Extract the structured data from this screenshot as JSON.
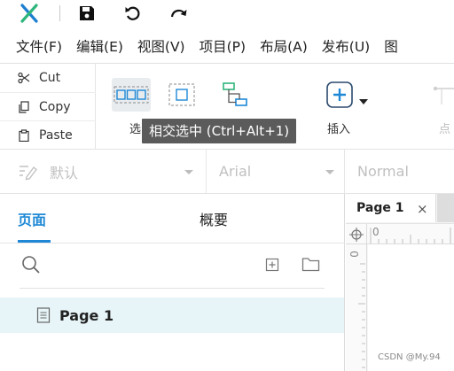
{
  "menu": [
    "文件(F)",
    "编辑(E)",
    "视图(V)",
    "项目(P)",
    "布局(A)",
    "发布(U)",
    "图"
  ],
  "clipboard": {
    "cut": "Cut",
    "copy": "Copy",
    "paste": "Paste"
  },
  "toolbar": {
    "select_label": "选",
    "insert_label": "插入",
    "point_label": "点",
    "tooltip": "相交选中 (Ctrl+Alt+1)"
  },
  "style": {
    "style_value": "默认",
    "font_value": "Arial",
    "weight_value": "Normal"
  },
  "panel": {
    "tab_pages": "页面",
    "tab_outline": "概要",
    "page_item": "Page 1"
  },
  "canvas": {
    "tab_title": "Page 1",
    "tab_close": "×",
    "ruler_zero": "0",
    "ruler_v_zero": "0"
  },
  "watermark": "CSDN @My.94",
  "colors": {
    "accent": "#1e88d6",
    "selected_row": "#e7f5f8",
    "logo_blue": "#1d7fd0",
    "logo_green": "#2fb67c",
    "tooltip_bg": "#5b5b5b"
  }
}
